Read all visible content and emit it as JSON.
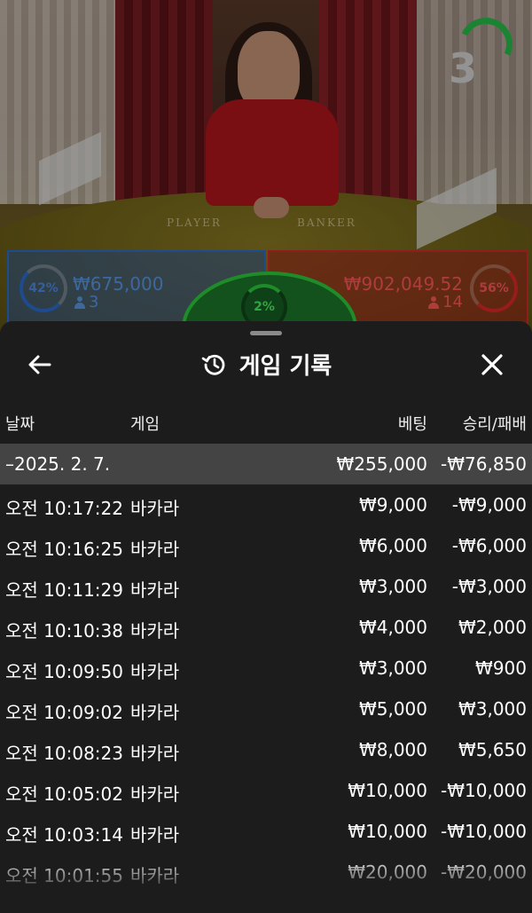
{
  "video": {
    "round_number": "3",
    "table_left_label": "PLAYER",
    "table_right_label": "BANKER"
  },
  "stats": {
    "player": {
      "percent": "42%",
      "amount": "₩675,000",
      "players": "3"
    },
    "tie": {
      "percent": "2%"
    },
    "banker": {
      "percent": "56%",
      "amount": "₩902,049.52",
      "players": "14"
    }
  },
  "sheet": {
    "title": "게임 기록",
    "columns": {
      "date": "날짜",
      "game": "게임",
      "bet": "베팅",
      "result": "승리/패배"
    },
    "summary": {
      "date": "–2025. 2. 7.",
      "bet": "₩255,000",
      "result": "-₩76,850"
    },
    "rows": [
      {
        "time": "오전 10:17:22",
        "game": "바카라",
        "bet": "₩9,000",
        "result": "-₩9,000"
      },
      {
        "time": "오전 10:16:25",
        "game": "바카라",
        "bet": "₩6,000",
        "result": "-₩6,000"
      },
      {
        "time": "오전 10:11:29",
        "game": "바카라",
        "bet": "₩3,000",
        "result": "-₩3,000"
      },
      {
        "time": "오전 10:10:38",
        "game": "바카라",
        "bet": "₩4,000",
        "result": "₩2,000"
      },
      {
        "time": "오전 10:09:50",
        "game": "바카라",
        "bet": "₩3,000",
        "result": "₩900"
      },
      {
        "time": "오전 10:09:02",
        "game": "바카라",
        "bet": "₩5,000",
        "result": "₩3,000"
      },
      {
        "time": "오전 10:08:23",
        "game": "바카라",
        "bet": "₩8,000",
        "result": "₩5,650"
      },
      {
        "time": "오전 10:05:02",
        "game": "바카라",
        "bet": "₩10,000",
        "result": "-₩10,000"
      },
      {
        "time": "오전 10:03:14",
        "game": "바카라",
        "bet": "₩10,000",
        "result": "-₩10,000"
      },
      {
        "time": "오전 10:01:55",
        "game": "바카라",
        "bet": "₩20,000",
        "result": "-₩20,000"
      }
    ]
  }
}
